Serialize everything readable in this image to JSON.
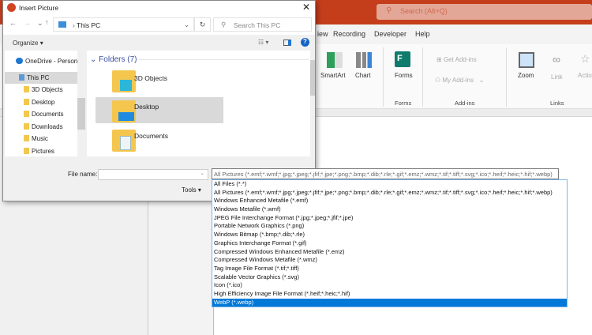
{
  "powerpoint": {
    "search_placeholder": "Search (Alt+Q)",
    "tabs": [
      "iew",
      "Recording",
      "Developer",
      "Help"
    ],
    "ribbon": {
      "smartart": "SmartArt",
      "chart": "Chart",
      "forms": "Forms",
      "get_addins": "Get Add-ins",
      "my_addins": "My Add-ins",
      "zoom": "Zoom",
      "link": "Link",
      "action": "Actio"
    },
    "groups": {
      "forms": "Forms",
      "addins": "Add-ins",
      "links": "Links"
    },
    "accent": "#c43e1c"
  },
  "dialog": {
    "title": "Insert Picture",
    "address": "This PC",
    "search_placeholder": "Search This PC",
    "organize": "Organize",
    "nav": [
      "OneDrive - Person",
      "This PC",
      "3D Objects",
      "Desktop",
      "Documents",
      "Downloads",
      "Music",
      "Pictures"
    ],
    "section": "Folders (7)",
    "folders": [
      "3D Objects",
      "Desktop",
      "Documents"
    ],
    "file_name_label": "File name:",
    "file_name_value": "",
    "tools": "Tools",
    "file_type_selected": "All Pictures (*.emf;*.wmf;*.jpg;*.jpeg;*.jfif;*.jpe;*.png;*.bmp;*.dib;*.rle;*.gif;*.emz;*.wmz;*.tif;*.tiff;*.svg;*.ico;*.heif;*.heic;*.hif;*.webp)",
    "file_type_options": [
      "All Files (*.*)",
      "All Pictures (*.emf;*.wmf;*.jpg;*.jpeg;*.jfif;*.jpe;*.png;*.bmp;*.dib;*.rle;*.gif;*.emz;*.wmz;*.tif;*.tiff;*.svg;*.ico;*.heif;*.heic;*.hif;*.webp)",
      "Windows Enhanced Metafile (*.emf)",
      "Windows Metafile (*.wmf)",
      "JPEG File Interchange Format (*.jpg;*.jpeg;*.jfif;*.jpe)",
      "Portable Network Graphics (*.png)",
      "Windows Bitmap (*.bmp;*.dib;*.rle)",
      "Graphics Interchange Format (*.gif)",
      "Compressed Windows Enhanced Metafile (*.emz)",
      "Compressed Windows Metafile (*.wmz)",
      "Tag Image File Format (*.tif;*.tiff)",
      "Scalable Vector Graphics (*.svg)",
      "Icon (*.ico)",
      "High Efficiency Image File Format (*.heif;*.heic;*.hif)",
      "WebP (*.webp)"
    ],
    "highlighted_option": "WebP (*.webp)"
  }
}
